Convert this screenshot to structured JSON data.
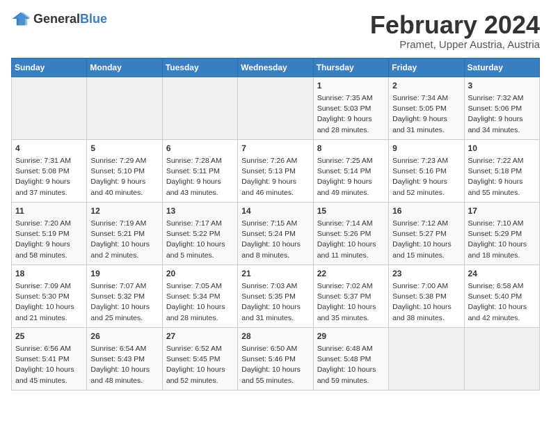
{
  "logo": {
    "text_general": "General",
    "text_blue": "Blue"
  },
  "title": "February 2024",
  "subtitle": "Pramet, Upper Austria, Austria",
  "days_of_week": [
    "Sunday",
    "Monday",
    "Tuesday",
    "Wednesday",
    "Thursday",
    "Friday",
    "Saturday"
  ],
  "weeks": [
    [
      {
        "day": "",
        "info": ""
      },
      {
        "day": "",
        "info": ""
      },
      {
        "day": "",
        "info": ""
      },
      {
        "day": "",
        "info": ""
      },
      {
        "day": "1",
        "info": "Sunrise: 7:35 AM\nSunset: 5:03 PM\nDaylight: 9 hours\nand 28 minutes."
      },
      {
        "day": "2",
        "info": "Sunrise: 7:34 AM\nSunset: 5:05 PM\nDaylight: 9 hours\nand 31 minutes."
      },
      {
        "day": "3",
        "info": "Sunrise: 7:32 AM\nSunset: 5:06 PM\nDaylight: 9 hours\nand 34 minutes."
      }
    ],
    [
      {
        "day": "4",
        "info": "Sunrise: 7:31 AM\nSunset: 5:08 PM\nDaylight: 9 hours\nand 37 minutes."
      },
      {
        "day": "5",
        "info": "Sunrise: 7:29 AM\nSunset: 5:10 PM\nDaylight: 9 hours\nand 40 minutes."
      },
      {
        "day": "6",
        "info": "Sunrise: 7:28 AM\nSunset: 5:11 PM\nDaylight: 9 hours\nand 43 minutes."
      },
      {
        "day": "7",
        "info": "Sunrise: 7:26 AM\nSunset: 5:13 PM\nDaylight: 9 hours\nand 46 minutes."
      },
      {
        "day": "8",
        "info": "Sunrise: 7:25 AM\nSunset: 5:14 PM\nDaylight: 9 hours\nand 49 minutes."
      },
      {
        "day": "9",
        "info": "Sunrise: 7:23 AM\nSunset: 5:16 PM\nDaylight: 9 hours\nand 52 minutes."
      },
      {
        "day": "10",
        "info": "Sunrise: 7:22 AM\nSunset: 5:18 PM\nDaylight: 9 hours\nand 55 minutes."
      }
    ],
    [
      {
        "day": "11",
        "info": "Sunrise: 7:20 AM\nSunset: 5:19 PM\nDaylight: 9 hours\nand 58 minutes."
      },
      {
        "day": "12",
        "info": "Sunrise: 7:19 AM\nSunset: 5:21 PM\nDaylight: 10 hours\nand 2 minutes."
      },
      {
        "day": "13",
        "info": "Sunrise: 7:17 AM\nSunset: 5:22 PM\nDaylight: 10 hours\nand 5 minutes."
      },
      {
        "day": "14",
        "info": "Sunrise: 7:15 AM\nSunset: 5:24 PM\nDaylight: 10 hours\nand 8 minutes."
      },
      {
        "day": "15",
        "info": "Sunrise: 7:14 AM\nSunset: 5:26 PM\nDaylight: 10 hours\nand 11 minutes."
      },
      {
        "day": "16",
        "info": "Sunrise: 7:12 AM\nSunset: 5:27 PM\nDaylight: 10 hours\nand 15 minutes."
      },
      {
        "day": "17",
        "info": "Sunrise: 7:10 AM\nSunset: 5:29 PM\nDaylight: 10 hours\nand 18 minutes."
      }
    ],
    [
      {
        "day": "18",
        "info": "Sunrise: 7:09 AM\nSunset: 5:30 PM\nDaylight: 10 hours\nand 21 minutes."
      },
      {
        "day": "19",
        "info": "Sunrise: 7:07 AM\nSunset: 5:32 PM\nDaylight: 10 hours\nand 25 minutes."
      },
      {
        "day": "20",
        "info": "Sunrise: 7:05 AM\nSunset: 5:34 PM\nDaylight: 10 hours\nand 28 minutes."
      },
      {
        "day": "21",
        "info": "Sunrise: 7:03 AM\nSunset: 5:35 PM\nDaylight: 10 hours\nand 31 minutes."
      },
      {
        "day": "22",
        "info": "Sunrise: 7:02 AM\nSunset: 5:37 PM\nDaylight: 10 hours\nand 35 minutes."
      },
      {
        "day": "23",
        "info": "Sunrise: 7:00 AM\nSunset: 5:38 PM\nDaylight: 10 hours\nand 38 minutes."
      },
      {
        "day": "24",
        "info": "Sunrise: 6:58 AM\nSunset: 5:40 PM\nDaylight: 10 hours\nand 42 minutes."
      }
    ],
    [
      {
        "day": "25",
        "info": "Sunrise: 6:56 AM\nSunset: 5:41 PM\nDaylight: 10 hours\nand 45 minutes."
      },
      {
        "day": "26",
        "info": "Sunrise: 6:54 AM\nSunset: 5:43 PM\nDaylight: 10 hours\nand 48 minutes."
      },
      {
        "day": "27",
        "info": "Sunrise: 6:52 AM\nSunset: 5:45 PM\nDaylight: 10 hours\nand 52 minutes."
      },
      {
        "day": "28",
        "info": "Sunrise: 6:50 AM\nSunset: 5:46 PM\nDaylight: 10 hours\nand 55 minutes."
      },
      {
        "day": "29",
        "info": "Sunrise: 6:48 AM\nSunset: 5:48 PM\nDaylight: 10 hours\nand 59 minutes."
      },
      {
        "day": "",
        "info": ""
      },
      {
        "day": "",
        "info": ""
      }
    ]
  ]
}
